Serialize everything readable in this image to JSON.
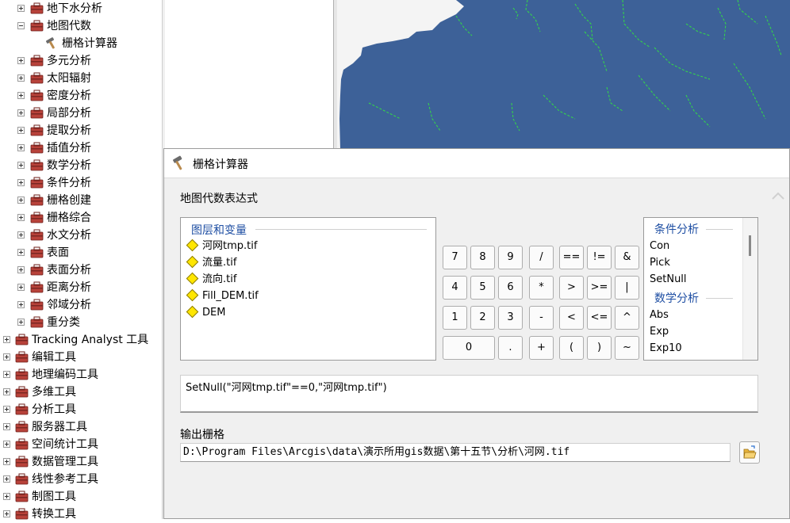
{
  "toolbox_tree": {
    "items": [
      {
        "label": "地下水分析",
        "level": 1,
        "expanded": false
      },
      {
        "label": "地图代数",
        "level": 1,
        "expanded": true
      },
      {
        "label": "栅格计算器",
        "level": 2,
        "is_tool": true
      },
      {
        "label": "多元分析",
        "level": 1,
        "expanded": false
      },
      {
        "label": "太阳辐射",
        "level": 1,
        "expanded": false
      },
      {
        "label": "密度分析",
        "level": 1,
        "expanded": false
      },
      {
        "label": "局部分析",
        "level": 1,
        "expanded": false
      },
      {
        "label": "提取分析",
        "level": 1,
        "expanded": false
      },
      {
        "label": "插值分析",
        "level": 1,
        "expanded": false
      },
      {
        "label": "数学分析",
        "level": 1,
        "expanded": false
      },
      {
        "label": "条件分析",
        "level": 1,
        "expanded": false
      },
      {
        "label": "栅格创建",
        "level": 1,
        "expanded": false
      },
      {
        "label": "栅格综合",
        "level": 1,
        "expanded": false
      },
      {
        "label": "水文分析",
        "level": 1,
        "expanded": false
      },
      {
        "label": "表面",
        "level": 1,
        "expanded": false
      },
      {
        "label": "表面分析",
        "level": 1,
        "expanded": false
      },
      {
        "label": "距离分析",
        "level": 1,
        "expanded": false
      },
      {
        "label": "邻域分析",
        "level": 1,
        "expanded": false
      },
      {
        "label": "重分类",
        "level": 1,
        "expanded": false
      },
      {
        "label": "Tracking Analyst 工具",
        "level": 0,
        "expanded": false
      },
      {
        "label": "编辑工具",
        "level": 0,
        "expanded": false
      },
      {
        "label": "地理编码工具",
        "level": 0,
        "expanded": false
      },
      {
        "label": "多维工具",
        "level": 0,
        "expanded": false
      },
      {
        "label": "分析工具",
        "level": 0,
        "expanded": false
      },
      {
        "label": "服务器工具",
        "level": 0,
        "expanded": false
      },
      {
        "label": "空间统计工具",
        "level": 0,
        "expanded": false
      },
      {
        "label": "数据管理工具",
        "level": 0,
        "expanded": false
      },
      {
        "label": "线性参考工具",
        "level": 0,
        "expanded": false
      },
      {
        "label": "制图工具",
        "level": 0,
        "expanded": false
      },
      {
        "label": "转换工具",
        "level": 0,
        "expanded": false
      }
    ]
  },
  "map": {
    "water_color": "#3d6198",
    "stream_color": "#33dd44",
    "background_color": "#f4f4f4"
  },
  "dialog": {
    "title": "栅格计算器",
    "expression_section_label": "地图代数表达式",
    "layers_header": "图层和变量",
    "layers": [
      "河网tmp.tif",
      "流量.tif",
      "流向.tif",
      "Fill_DEM.tif",
      "DEM"
    ],
    "keypad": {
      "digits": [
        [
          "7",
          "8",
          "9"
        ],
        [
          "4",
          "5",
          "6"
        ],
        [
          "1",
          "2",
          "3"
        ]
      ],
      "zero": "0",
      "dot": ".",
      "operators": [
        [
          "/",
          "==",
          "!=",
          "&"
        ],
        [
          "*",
          ">",
          ">=",
          "|"
        ],
        [
          "-",
          "<",
          "<=",
          "^"
        ],
        [
          "+",
          "(",
          ")",
          "~"
        ]
      ]
    },
    "functions": {
      "groups": [
        {
          "header": "条件分析",
          "items": [
            "Con",
            "Pick",
            "SetNull"
          ]
        },
        {
          "header": "数学分析",
          "items": [
            "Abs",
            "Exp",
            "Exp10"
          ]
        }
      ]
    },
    "expression": "SetNull(\"河网tmp.tif\"==0,\"河网tmp.tif\")",
    "output_label": "输出栅格",
    "output_path": "D:\\Program Files\\Arcgis\\data\\演示所用gis数据\\第十五节\\分析\\河网.tif",
    "accent_color": "#1f4fa3"
  }
}
